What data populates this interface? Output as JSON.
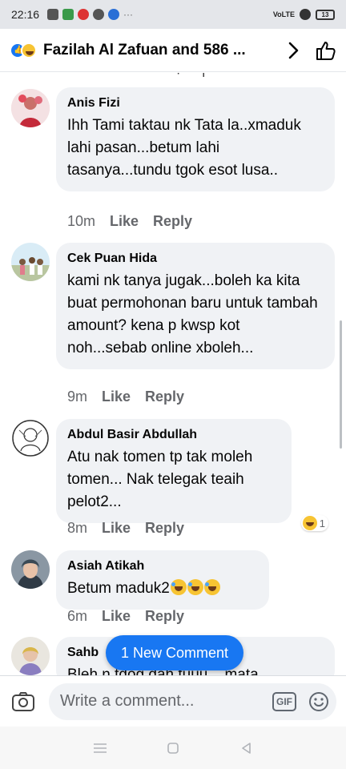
{
  "status_bar": {
    "time": "22:16",
    "network": "VoLTE",
    "battery": "13"
  },
  "header": {
    "title": "Fazilah Al Zafuan and 586 ..."
  },
  "comments": [
    {
      "author": "Anis Fizi",
      "text": "Ihh Tami taktau nk Tata la..xmaduk lahi pasan...betum lahi tasanya...tundu tgok esot lusa..",
      "time": "10m",
      "like": "Like",
      "reply": "Reply"
    },
    {
      "author": "Cek Puan Hida",
      "text": "kami nk tanya jugak...boleh ka kita buat permohonan baru untuk tambah amount? kena p kwsp kot noh...sebab online xboleh...",
      "time": "9m",
      "like": "Like",
      "reply": "Reply"
    },
    {
      "author": "Abdul Basir Abdullah",
      "text": "Atu nak tomen tp tak moleh tomen... Nak telegak teaih pelot2...",
      "time": "8m",
      "like": "Like",
      "reply": "Reply",
      "reaction_count": "1"
    },
    {
      "author": "Asiah Atikah",
      "text": "Betum maduk2",
      "time": "6m",
      "like": "Like",
      "reply": "Reply"
    },
    {
      "author": "Sahb",
      "text": "Bleh n tdog dah tuuu... mata"
    }
  ],
  "new_comment_pill": "1 New Comment",
  "composer": {
    "placeholder": "Write a comment...",
    "gif_label": "GIF"
  },
  "colors": {
    "accent": "#1877f2",
    "bubble": "#f0f2f5",
    "meta": "#65676b"
  }
}
